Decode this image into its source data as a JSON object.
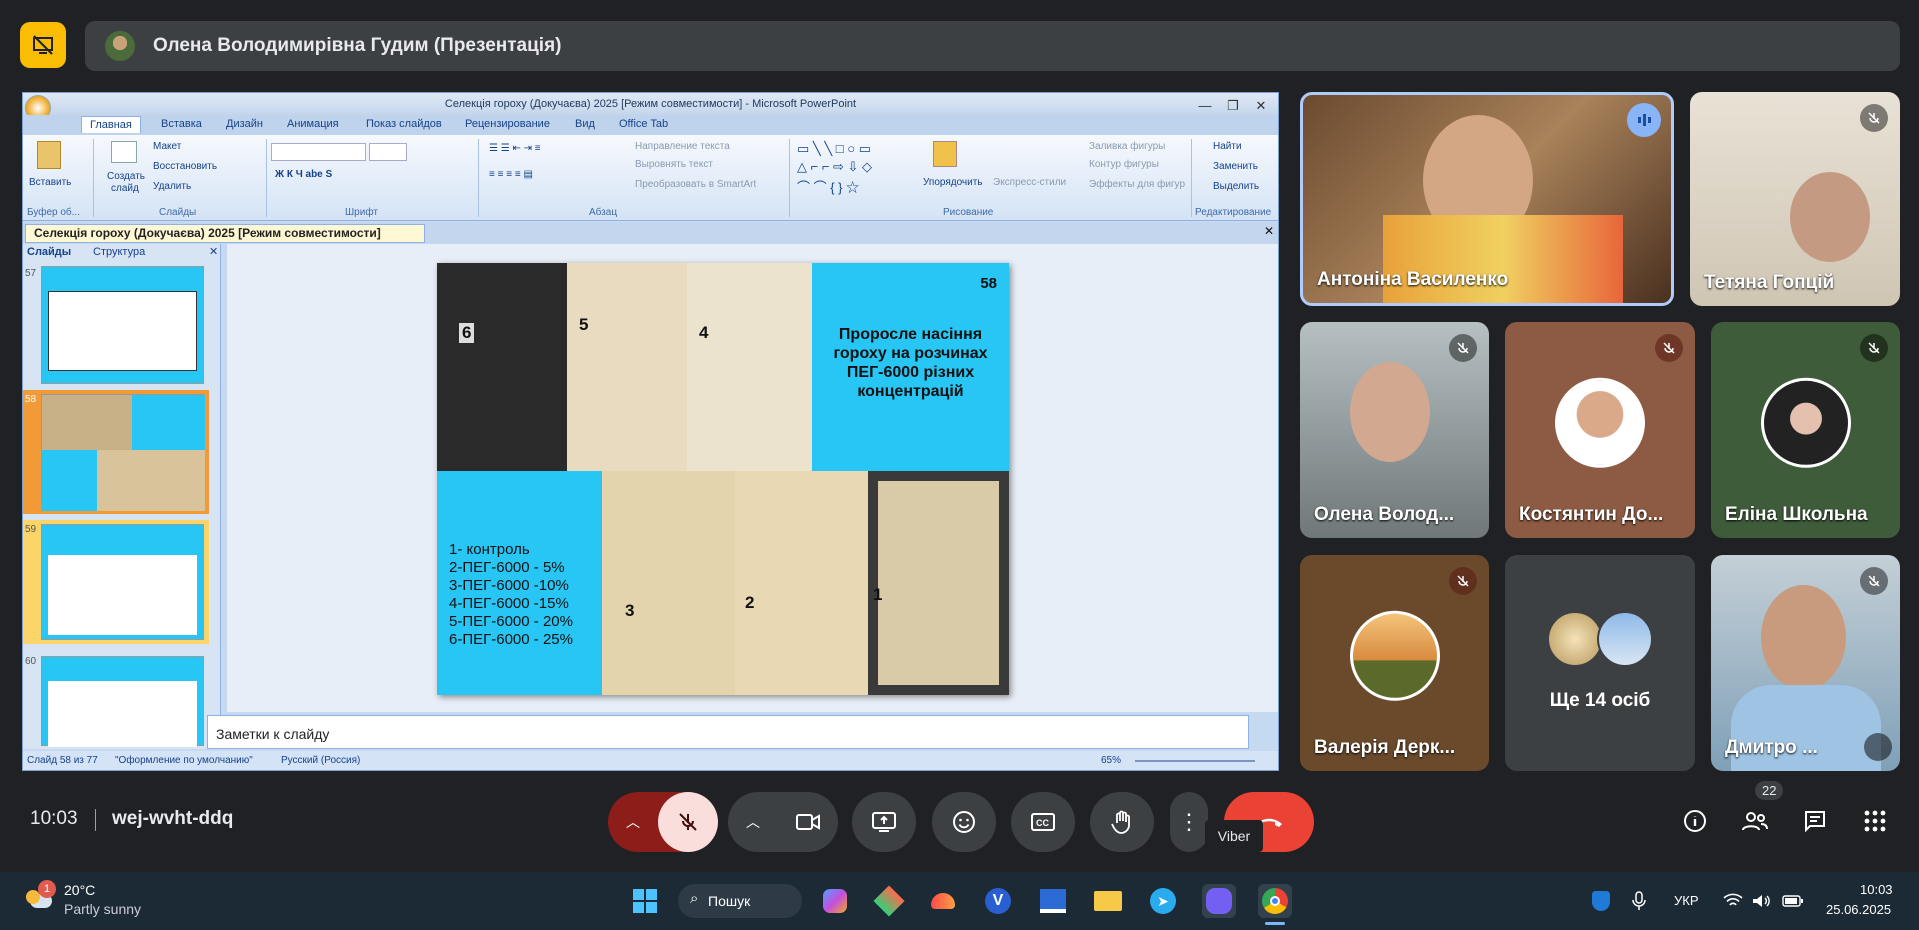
{
  "meeting": {
    "presenter_label": "Олена Володимирівна Гудим (Презентація)",
    "time": "10:03",
    "code": "wej-wvht-ddq",
    "participants_count": "22",
    "tooltip": "Viber"
  },
  "ppt": {
    "window_title": "Селекція гороху (Докучаєва) 2025 [Режим совместимости] - Microsoft PowerPoint",
    "tabs": [
      "Главная",
      "Вставка",
      "Дизайн",
      "Анимация",
      "Показ слайдов",
      "Рецензирование",
      "Вид",
      "Office Tab"
    ],
    "groups": {
      "clipboard": "Буфер об...",
      "slides": "Слайды",
      "font": "Шрифт",
      "paragraph": "Абзац",
      "drawing": "Рисование",
      "editing": "Редактирование"
    },
    "buttons": {
      "paste": "Вставить",
      "new_slide_1": "Создать",
      "new_slide_2": "слайд",
      "layout": "Макет",
      "reset": "Восстановить",
      "delete": "Удалить",
      "text_direction": "Направление текста",
      "align_text": "Выровнять текст",
      "smartart": "Преобразовать в SmartArt",
      "arrange": "Упорядочить",
      "quick_styles": "Экспресс-стили",
      "shape_fill": "Заливка фигуры",
      "shape_outline": "Контур фигуры",
      "shape_effects": "Эффекты для фигур",
      "find": "Найти",
      "replace": "Заменить",
      "select": "Выделить"
    },
    "doc_tab": "Селекція гороху (Докучаєва) 2025 [Режим совместимости]",
    "sidebar_tabs": [
      "Слайды",
      "Структура"
    ],
    "thumb_numbers": [
      "57",
      "58",
      "59",
      "60"
    ],
    "notes_placeholder": "Заметки к слайду",
    "status": {
      "slide": "Слайд 58 из 77",
      "theme": "\"Оформление по умолчанию\"",
      "lang": "Русский (Россия)",
      "zoom": "65%"
    }
  },
  "slide": {
    "number": "58",
    "title": "Проросле насіння гороху на розчинах ПЕГ-6000 різних концентрацій",
    "legend": [
      "1- контроль",
      "2-ПЕГ-6000 - 5%",
      "3-ПЕГ-6000 -10%",
      "4-ПЕГ-6000 -15%",
      "5-ПЕГ-6000 - 20%",
      "6-ПЕГ-6000 - 25%"
    ],
    "tray_labels": [
      "6",
      "5",
      "4",
      "3",
      "2",
      "1"
    ]
  },
  "participants": [
    {
      "name": "Антоніна Василенко",
      "speaking": true
    },
    {
      "name": "Тетяна Гопцій"
    },
    {
      "name": "Олена Волод..."
    },
    {
      "name": "Костянтин До..."
    },
    {
      "name": "Еліна Школьна"
    },
    {
      "name": "Валерія Дерк..."
    },
    {
      "name": "Ще 14 осіб"
    },
    {
      "name": "Дмитро ..."
    }
  ],
  "taskbar": {
    "weather_temp": "20°C",
    "weather_desc": "Partly sunny",
    "weather_badge": "1",
    "search": "Пошук",
    "lang": "УКР",
    "clock_time": "10:03",
    "clock_date": "25.06.2025"
  },
  "colors": {
    "accent_yellow": "#fbbc04",
    "end_call": "#ea4335",
    "mic_off_bg": "#f9dedc",
    "slide_cyan": "#27c6f4"
  }
}
